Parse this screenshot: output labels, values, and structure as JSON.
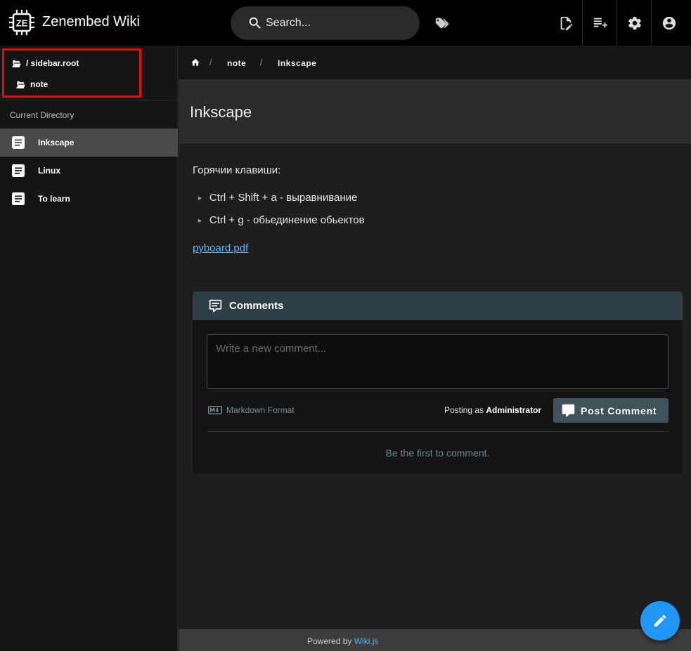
{
  "header": {
    "app_title": "Zenembed Wiki",
    "logo_text": "ZE",
    "search_placeholder": "Search..."
  },
  "sidebar": {
    "tree": [
      {
        "label": "/ sidebar.root",
        "icon": "folder-open-icon"
      },
      {
        "label": "note",
        "icon": "folder-open-icon"
      }
    ],
    "subheader": "Current Directory",
    "items": [
      {
        "label": "Inkscape",
        "active": true
      },
      {
        "label": "Linux",
        "active": false
      },
      {
        "label": "To learn",
        "active": false
      }
    ]
  },
  "breadcrumb": {
    "items": [
      "note",
      "Inkscape"
    ],
    "separator": "/"
  },
  "page": {
    "title": "Inkscape",
    "paragraph": "Горячии клавиши:",
    "list": [
      "Ctrl + Shift + a - выравнивание",
      "Ctrl + g - обьединение обьектов"
    ],
    "link": "pyboard.pdf"
  },
  "comments": {
    "title": "Comments",
    "placeholder": "Write a new comment...",
    "markdown_label": "Markdown Format",
    "posting_as_prefix": "Posting as",
    "posting_as_user": "Administrator",
    "post_button": "Post Comment",
    "empty_text": "Be the first to comment."
  },
  "footer": {
    "prefix": "Powered by",
    "link": "Wiki.js"
  },
  "colors": {
    "accent": "#2196f3",
    "link": "#64b5f6",
    "comment_header": "#2e3e47",
    "highlight_box": "#e01010"
  }
}
